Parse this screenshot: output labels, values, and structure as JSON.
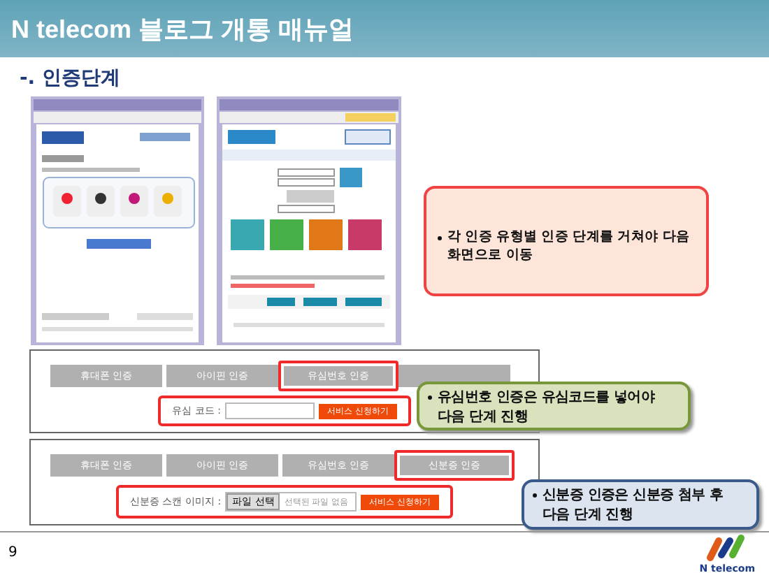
{
  "header": {
    "title": "N telecom 블로그 개통 매뉴얼"
  },
  "section_title": "-. 인증단계",
  "screenshots": [
    {
      "kind": "siren"
    },
    {
      "kind": "ipin"
    }
  ],
  "callouts": [
    {
      "kind": "red",
      "text": "각 인증 유형별 인증 단계를 거쳐야 다음 화면으로 이동"
    },
    {
      "kind": "green",
      "text": "유심번호 인증은 유심코드를 넣어야 다음 단계 진행"
    },
    {
      "kind": "blue",
      "text": "신분증 인증은 신분증 첨부 후 다음 단계 진행"
    }
  ],
  "panels": [
    {
      "tabs": [
        {
          "label": "휴대폰 인증",
          "selected": false
        },
        {
          "label": "아이핀 인증",
          "selected": false
        },
        {
          "label": "유심번호 인증",
          "selected": true
        },
        {
          "selected": false
        }
      ],
      "form": {
        "kind": "text",
        "label": "유심 코드 :",
        "highlighted": true,
        "submit": "서비스 신청하기"
      }
    },
    {
      "tabs": [
        {
          "label": "휴대폰 인증",
          "selected": false
        },
        {
          "label": "아이핀 인증",
          "selected": false
        },
        {
          "label": "유심번호 인증",
          "selected": false
        },
        {
          "label": "신분증 인증",
          "selected": true
        }
      ],
      "form": {
        "kind": "file",
        "label": "신분증 스캔 이미지 :",
        "file_button": "파일 선택",
        "file_status": "선택된 파일 없음",
        "highlighted": true,
        "submit": "서비스 신청하기"
      }
    }
  ],
  "footer": {
    "page": "9",
    "logo": "N telecom"
  }
}
